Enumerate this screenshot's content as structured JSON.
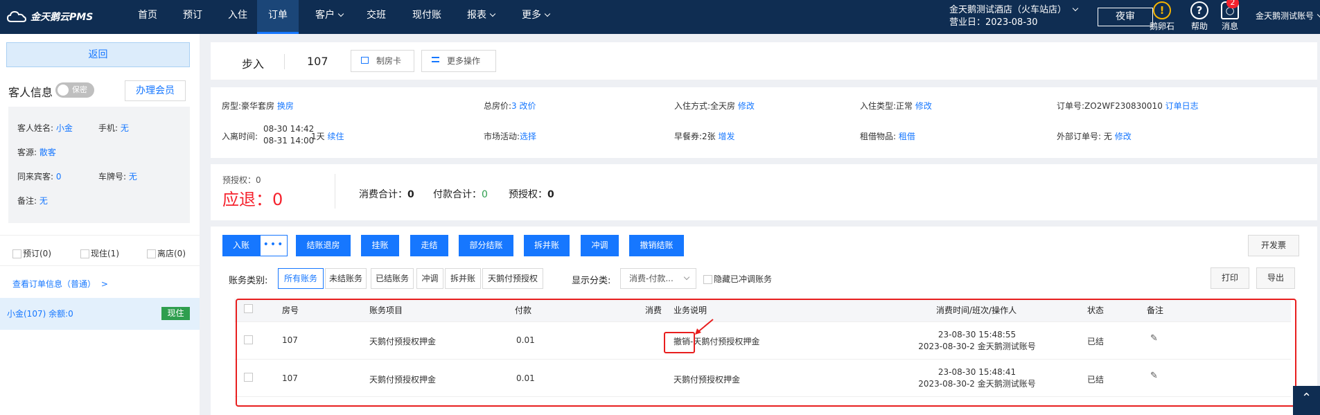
{
  "app": {
    "name": "金天鹅云PMS"
  },
  "nav": {
    "items": [
      "首页",
      "预订",
      "入住",
      "订单",
      "客户",
      "交班",
      "现付账",
      "报表",
      "更多"
    ],
    "active": "订单"
  },
  "header": {
    "hotel": "金天鹅测试酒店（火车站店）",
    "business_day": "营业日：2023-08-30",
    "night_audit": "夜审",
    "egg": "鹅卵石",
    "help": "帮助",
    "messages": "消息",
    "msg_count": "2",
    "user": "金天鹅测试账号"
  },
  "left": {
    "back": "返回",
    "guest_title": "客人信息",
    "privacy": "保密",
    "member": "办理会员",
    "name_label": "客人姓名:",
    "name": "小金",
    "phone_label": "手机:",
    "phone": "无",
    "source_label": "客源:",
    "source": "散客",
    "companions_label": "同来宾客:",
    "companions": "0",
    "plate_label": "车牌号:",
    "plate": "无",
    "note_label": "备注:",
    "note": "无",
    "reserved": "预订(0)",
    "inhouse": "现住(1)",
    "left_count": "离店(0)",
    "view_order": "查看订单信息（普通）",
    "gt": ">",
    "room_entry": "小金(107)  余额:0",
    "room_status": "现住"
  },
  "top": {
    "step": "步入",
    "room": "107",
    "make_card": "制房卡",
    "more_ops": "更多操作"
  },
  "info": {
    "room_type_label": "房型:",
    "room_type": "豪华套房",
    "change_room": "换房",
    "total_label": "总房价:",
    "total_count": "3",
    "price_change": "改价",
    "checkin_mode_label": "入住方式:",
    "checkin_mode": "全天房",
    "edit1": "修改",
    "checkin_type_label": "入住类型:",
    "checkin_type": "正常",
    "edit2": "修改",
    "order_label": "订单号:",
    "order_no": "ZO2WF230830010",
    "order_log": "订单日志",
    "time_label": "入离时间:",
    "arrive": "08-30 14:42",
    "depart": "08-31 14:00",
    "nights": "1天",
    "extend": "续住",
    "market_label": "市场活动:",
    "market": "选择",
    "breakfast_label": "早餐券:",
    "breakfast": "2张",
    "add": "增发",
    "rent_label": "租借物品:",
    "rent": "租借",
    "ext_label": "外部订单号:",
    "ext": "无",
    "edit3": "修改"
  },
  "summary": {
    "pre_auth": "预授权：0",
    "refund_label": "应退：",
    "refund": "0",
    "consume_label": "消费合计：",
    "consume": "0",
    "pay_label": "付款合计：",
    "pay": "0",
    "auth_label": "预授权：",
    "auth": "0"
  },
  "actions": {
    "post": "入账",
    "dots": "•••",
    "settle_checkout": "结账退房",
    "hang": "挂账",
    "walk": "走结",
    "partial": "部分结账",
    "split": "拆并账",
    "adjust": "冲调",
    "cancel_settle": "撤销结账",
    "invoice": "开发票"
  },
  "filters": {
    "cat_label": "账务类别:",
    "cats": [
      "所有账务",
      "未结账务",
      "已结账务",
      "冲调",
      "拆并账",
      "天鹅付预授权"
    ],
    "disp_label": "显示分类:",
    "disp_value": "消费-付款...",
    "hide_adjusted": "隐藏已冲调账务",
    "print": "打印",
    "export": "导出"
  },
  "table": {
    "headers": [
      "房号",
      "账务项目",
      "付款",
      "消费",
      "业务说明",
      "消费时间/班次/操作人",
      "状态",
      "备注"
    ],
    "rows": [
      {
        "room": "107",
        "item": "天鹅付预授权押金",
        "pay": "0.01",
        "consume": "",
        "desc_prefix": "撤销",
        "desc": "-天鹅付预授权押金",
        "time": "23-08-30 15:48:55",
        "shift": "2023-08-30-2 金天鹅测试账号",
        "status": "已结"
      },
      {
        "room": "107",
        "item": "天鹅付预授权押金",
        "pay": "0.01",
        "consume": "",
        "desc_prefix": "",
        "desc": "天鹅付预授权押金",
        "time": "23-08-30 15:48:41",
        "shift": "2023-08-30-2 金天鹅测试账号",
        "status": "已结"
      }
    ]
  }
}
